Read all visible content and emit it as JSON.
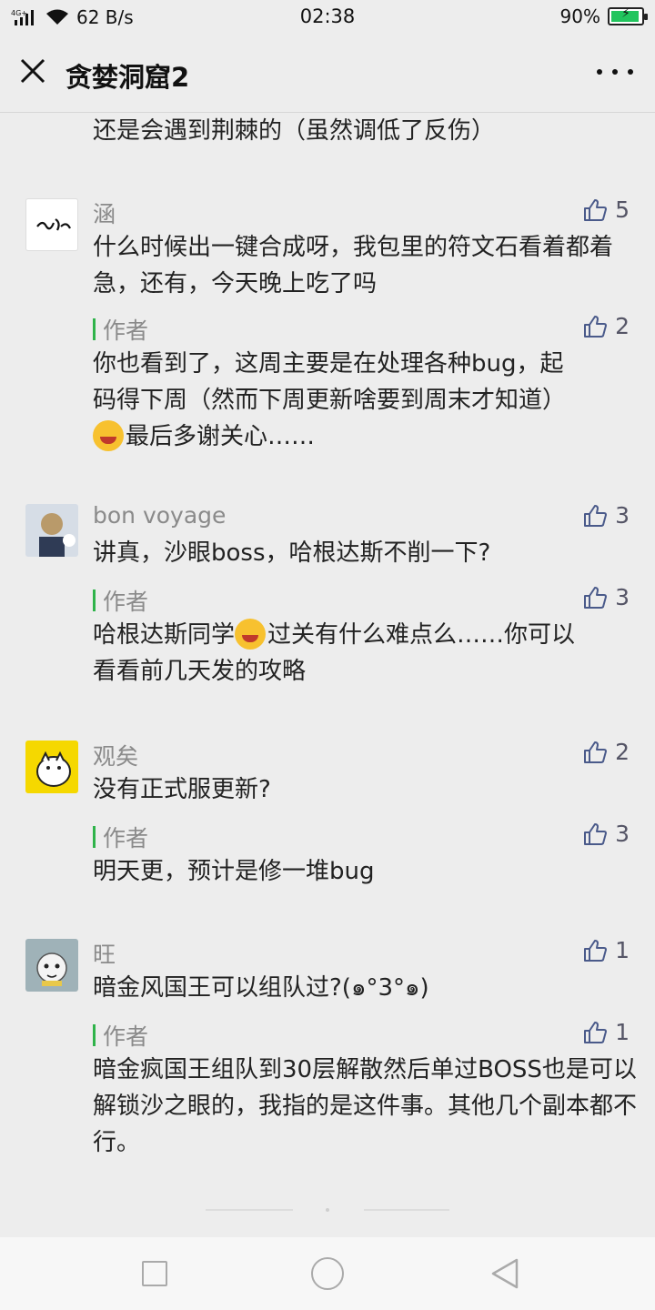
{
  "status": {
    "network_label": "4G+",
    "speed": "62 B/s",
    "time": "02:38",
    "battery": "90%"
  },
  "header": {
    "title": "贪婪洞窟2"
  },
  "partial": {
    "text": "还是会遇到荆棘的（虽然调低了反伤）"
  },
  "comments": [
    {
      "author": "涵",
      "likes": "5",
      "text": "什么时候出一键合成呀，我包里的符文石看着都着急，还有，今天晚上吃了吗",
      "reply_label": "作者",
      "reply_likes": "2",
      "reply_line1": "你也看到了，这周主要是在处理各种bug，起",
      "reply_line2": "码得下周（然而下周更新啥要到周末才知道）",
      "reply_line3": "最后多谢关心……"
    },
    {
      "author": "bon voyage",
      "likes": "3",
      "text": "讲真，沙眼boss，哈根达斯不削一下?",
      "reply_label": "作者",
      "reply_likes": "3",
      "reply_line1_a": "哈根达斯同学",
      "reply_line1_b": "过关有什么难点么……你可以",
      "reply_line2": "看看前几天发的攻略"
    },
    {
      "author": "观矣",
      "likes": "2",
      "text": "没有正式服更新?",
      "reply_label": "作者",
      "reply_likes": "3",
      "reply_text": "明天更，预计是修一堆bug"
    },
    {
      "author": "旺",
      "likes": "1",
      "text": "暗金风国王可以组队过?(๑°3°๑)",
      "reply_label": "作者",
      "reply_likes": "1",
      "reply_text": "暗金疯国王组队到30层解散然后单过BOSS也是可以解锁沙之眼的，我指的是这件事。其他几个副本都不行。"
    }
  ],
  "colors": {
    "background": "#ededed",
    "accent_green": "#2fb34a",
    "like_icon": "#4a5a8a"
  }
}
